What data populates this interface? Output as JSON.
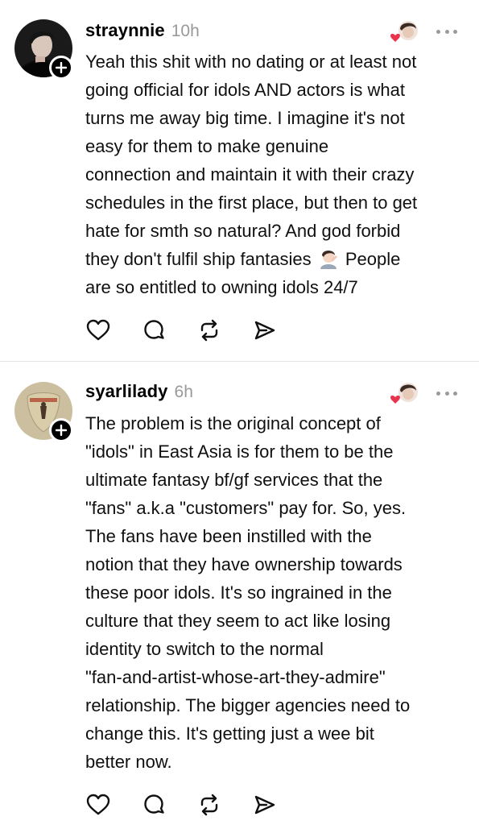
{
  "posts": [
    {
      "username": "straynnie",
      "time": "10h",
      "text_before_emoji": "Yeah this shit with no dating or at least not\ngoing official for idols AND actors is what\nturns me away big time. I imagine it's not\neasy for them to make genuine\nconnection and maintain it with their crazy\nschedules in the first place, but then to get\nhate for smth so natural? And god forbid\nthey don't fulfil ship fantasies ",
      "emoji_icon": "person-facepalming-emoji",
      "text_after_emoji": " People\nare so entitled to owning idols 24/7"
    },
    {
      "username": "syarlilady",
      "time": "6h",
      "text": "The problem is the original concept of\n\"idols\" in East Asia is for them to be the\nultimate fantasy bf/gf services that the\n\"fans\" a.k.a \"customers\" pay for. So, yes.\nThe fans have been instilled with the\nnotion that they have ownership towards\nthese poor idols. It's so ingrained in the\nculture that they seem to act like losing\nidentity to switch to the normal\n\"fan-and-artist-whose-art-they-admire\"\nrelationship. The bigger agencies need to\nchange this. It's getting just a wee bit\nbetter now."
    }
  ],
  "icons": [
    "plus-icon",
    "heart-reaction-icon",
    "more-options-icon",
    "like-icon",
    "reply-icon",
    "repost-icon",
    "share-icon"
  ]
}
